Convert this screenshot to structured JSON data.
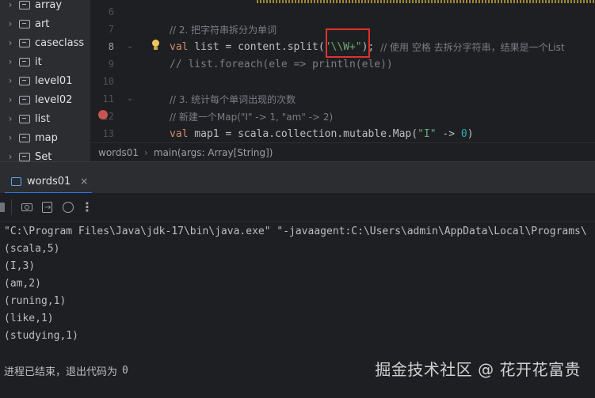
{
  "project_tree": {
    "items": [
      {
        "label": "array"
      },
      {
        "label": "art"
      },
      {
        "label": "caseclass"
      },
      {
        "label": "it"
      },
      {
        "label": "level01"
      },
      {
        "label": "level02"
      },
      {
        "label": "list"
      },
      {
        "label": "map"
      },
      {
        "label": "Set"
      }
    ]
  },
  "editor": {
    "gutter": [
      "6",
      "7",
      "8",
      "9",
      "10",
      "11",
      "12",
      "13"
    ],
    "lines": {
      "l7": "// 2. 把字符串拆分为单词",
      "l8_kw": "val",
      "l8_code": " list = content.split(",
      "l8_str": "\"\\\\W+\"",
      "l8_end": "); ",
      "l8_cmt": "// 使用 空格 去拆分字符串，结果是一个List",
      "l9": "// list.foreach(ele => println(ele))",
      "l11": "// 3. 统计每个单词出现的次数",
      "l12": "// 新建一个Map(\"I\" -> 1, \"am\" -> 2)",
      "l13_kw": "val",
      "l13_code": " map1 = scala.collection.mutable.Map(",
      "l13_str": "\"I\"",
      "l13_arrow": " -> ",
      "l13_num": "0",
      "l13_end": ")"
    }
  },
  "breadcrumb": {
    "object": "words01",
    "method": "main(args: Array[String])"
  },
  "run_window": {
    "tab_label": "words01",
    "close_symbol": "×",
    "more_symbol": "⋮"
  },
  "console": {
    "command": "\"C:\\Program Files\\Java\\jdk-17\\bin\\java.exe\" \"-javaagent:C:\\Users\\admin\\AppData\\Local\\Programs\\",
    "output": [
      "(scala,5)",
      "(I,3)",
      "(am,2)",
      "(runing,1)",
      "(like,1)",
      "(studying,1)"
    ],
    "exit_text": "进程已结束，退出代码为",
    "exit_code": "0"
  },
  "watermark": "掘金技术社区 @ 花开花富贵",
  "colors": {
    "background": "#1e1f22",
    "panel": "#2b2d30",
    "keyword": "#cf8e6d",
    "string": "#6aab73",
    "comment": "#7a7e85",
    "number": "#2aacb8",
    "highlight_box": "#e0322e",
    "accent": "#3574f0"
  },
  "icons": {
    "tree_chevron": "chevron-right-icon",
    "tree_folder": "folder-icon",
    "gutter_bulb": "lightbulb-icon",
    "gutter_breakpoint": "breakpoint-icon",
    "run_tab": "console-icon",
    "toolbar": [
      "stop-icon",
      "screenshot-icon",
      "export-icon",
      "clear-icon",
      "more-icon"
    ]
  }
}
